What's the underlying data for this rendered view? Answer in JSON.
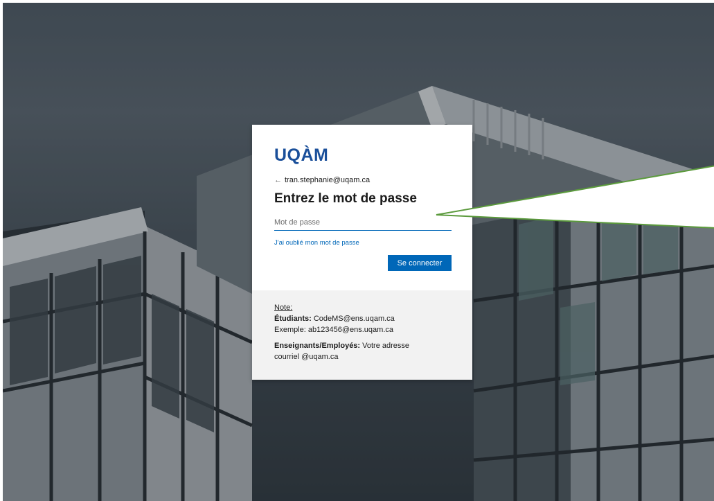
{
  "login": {
    "logo": "UQÀM",
    "back_icon": "back-arrow-icon",
    "account": "tran.stephanie@uqam.ca",
    "heading": "Entrez le mot de passe",
    "password_placeholder": "Mot de passe",
    "password_value": "",
    "forgot_link": "J'ai oublié mon mot de passe",
    "submit_label": "Se connecter"
  },
  "note": {
    "title": "Note:",
    "students_label": "Étudiants:",
    "students_value": "CodeMS@ens.uqam.ca",
    "example": "Exemple: ab123456@ens.uqam.ca",
    "staff_label": "Enseignants/Employés:",
    "staff_value": "Votre adresse",
    "staff_value_2": "courriel @uqam.ca"
  },
  "colors": {
    "brand": "#1a4f9a",
    "accent": "#0067b8",
    "callout_border": "#5b9a3c"
  }
}
